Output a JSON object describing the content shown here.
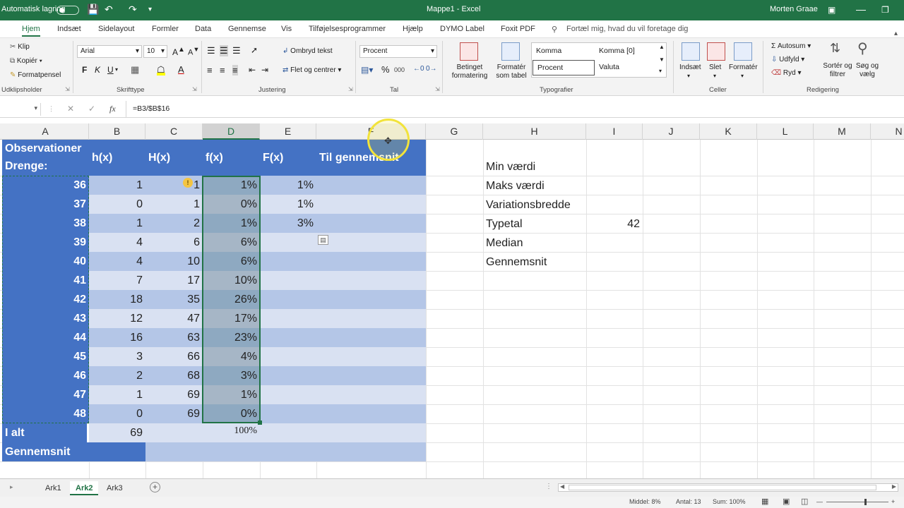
{
  "titlebar": {
    "autosave": "Automatisk lagring",
    "doc_title": "Mappe1 - Excel",
    "user": "Morten Graae"
  },
  "menu": {
    "tabs": [
      "Hjem",
      "Indsæt",
      "Sidelayout",
      "Formler",
      "Data",
      "Gennemse",
      "Vis",
      "Tilføjelsesprogrammer",
      "Hjælp",
      "DYMO Label",
      "Foxit PDF"
    ],
    "tell_me": "Fortæl mig, hvad du vil foretage dig"
  },
  "ribbon": {
    "clipboard": {
      "cut": "Klip",
      "copy": "Kopiér",
      "painter": "Formatpensel",
      "label": "Udklipsholder"
    },
    "font": {
      "name": "Arial",
      "size": "10",
      "label": "Skrifttype",
      "bold": "F",
      "italic": "K",
      "underline": "U"
    },
    "alignment": {
      "wrap": "Ombryd tekst",
      "merge": "Flet og centrer",
      "label": "Justering"
    },
    "number": {
      "format": "Procent",
      "percent": "%",
      "thousands": "000",
      "label": "Tal"
    },
    "styles": {
      "cond": "Betinget formatering",
      "astable": "Formatér som tabel",
      "cells": [
        "Komma",
        "Komma [0]",
        "Procent",
        "Valuta"
      ],
      "label": "Typografier"
    },
    "cells": {
      "insert": "Indsæt",
      "delete": "Slet",
      "format": "Formatér",
      "label": "Celler"
    },
    "editing": {
      "autosum": "Autosum",
      "fill": "Udfyld",
      "clear": "Ryd",
      "sort": "Sortér og filtrer",
      "find": "Søg og vælg",
      "label": "Redigering"
    }
  },
  "formula_bar": {
    "fx": "fx",
    "formula": "=B3/$B$16"
  },
  "columns": [
    "A",
    "B",
    "C",
    "D",
    "E",
    "F",
    "G",
    "H",
    "I",
    "J",
    "K",
    "L",
    "M",
    "N"
  ],
  "table": {
    "headers": {
      "a1": "Observationer",
      "a2": "Drenge:",
      "b": "h(x)",
      "c": "H(x)",
      "d": "f(x)",
      "e": "F(x)",
      "f": "Til gennemsnit"
    },
    "rows": [
      {
        "x": "36",
        "h": "1",
        "H": "1",
        "f": "1%",
        "F": "1%"
      },
      {
        "x": "37",
        "h": "0",
        "H": "1",
        "f": "0%",
        "F": "1%"
      },
      {
        "x": "38",
        "h": "1",
        "H": "2",
        "f": "1%",
        "F": "3%"
      },
      {
        "x": "39",
        "h": "4",
        "H": "6",
        "f": "6%",
        "F": ""
      },
      {
        "x": "40",
        "h": "4",
        "H": "10",
        "f": "6%",
        "F": ""
      },
      {
        "x": "41",
        "h": "7",
        "H": "17",
        "f": "10%",
        "F": ""
      },
      {
        "x": "42",
        "h": "18",
        "H": "35",
        "f": "26%",
        "F": ""
      },
      {
        "x": "43",
        "h": "12",
        "H": "47",
        "f": "17%",
        "F": ""
      },
      {
        "x": "44",
        "h": "16",
        "H": "63",
        "f": "23%",
        "F": ""
      },
      {
        "x": "45",
        "h": "3",
        "H": "66",
        "f": "4%",
        "F": ""
      },
      {
        "x": "46",
        "h": "2",
        "H": "68",
        "f": "3%",
        "F": ""
      },
      {
        "x": "47",
        "h": "1",
        "H": "69",
        "f": "1%",
        "F": ""
      },
      {
        "x": "48",
        "h": "0",
        "H": "69",
        "f": "0%",
        "F": ""
      }
    ],
    "total": {
      "label": "I alt",
      "h": "69",
      "f": "100%"
    },
    "mean_label": "Gennemsnit"
  },
  "stats": [
    {
      "label": "Min værdi",
      "value": ""
    },
    {
      "label": "Maks værdi",
      "value": ""
    },
    {
      "label": "Variationsbredde",
      "value": ""
    },
    {
      "label": "Typetal",
      "value": "42"
    },
    {
      "label": "Median",
      "value": ""
    },
    {
      "label": "Gennemsnit",
      "value": ""
    }
  ],
  "sheets": [
    "Ark1",
    "Ark2",
    "Ark3"
  ],
  "active_sheet": "Ark2",
  "status": {
    "avg": "Middel: 8%",
    "count": "Antal: 13",
    "sum": "Sum: 100%",
    "zoom": "100%"
  },
  "colors": {
    "accent": "#217346",
    "header_blue": "#4472c4",
    "band1": "#b4c6e7",
    "band2": "#d9e1f2"
  }
}
